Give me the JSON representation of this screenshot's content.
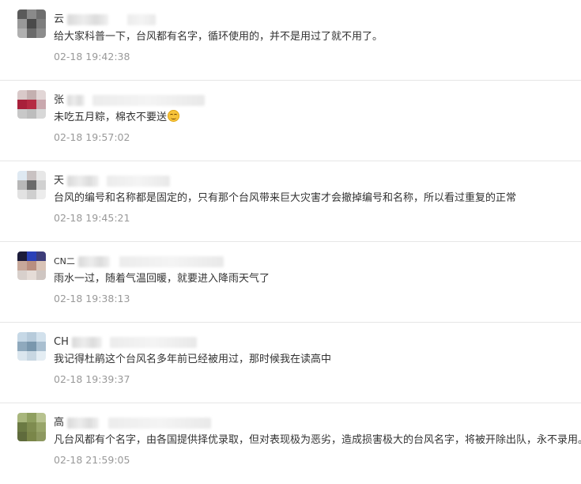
{
  "comments": [
    {
      "name": "云",
      "content": "给大家科普一下，台风都有名字，循环使用的，并不是用过了就不用了。",
      "time": "02-18 19:42:38",
      "avatar_colors": [
        "#5a5a5a",
        "#8a8a8a",
        "#6e6e6e",
        "#999999",
        "#4a4a4a",
        "#7d7d7d",
        "#b0b0b0",
        "#6a6a6a",
        "#8c8c8c"
      ]
    },
    {
      "name": "张",
      "content": "未吃五月粽，棉衣不要送",
      "emoji": "smile-emoji",
      "time": "02-18 19:57:02",
      "avatar_colors": [
        "#d9c9c9",
        "#c4b0b0",
        "#e2d6d6",
        "#a8203a",
        "#b52a42",
        "#c9a8ae",
        "#c8c8c8",
        "#bdbdbd",
        "#d8d8d8"
      ]
    },
    {
      "name": "天",
      "content": "台风的编号和名称都是固定的，只有那个台风带来巨大灾害才会撤掉编号和名称，所以看过重复的正常",
      "time": "02-18 19:45:21",
      "avatar_colors": [
        "#dfe9f2",
        "#c9c2c2",
        "#e7e7e7",
        "#b8b8b8",
        "#6a6a6a",
        "#d1d1d1",
        "#e2e2e2",
        "#cfcfcf",
        "#ececec"
      ]
    },
    {
      "name": "CN二",
      "content": "雨水一过，随着气温回暖，就要进入降雨天气了",
      "time": "02-18 19:38:13",
      "avatar_colors": [
        "#1b1b3a",
        "#2a40b8",
        "#3d3d7a",
        "#c7a89a",
        "#b98f80",
        "#d9c3b6",
        "#d8d0cc",
        "#e5dcd7",
        "#cfc6c2"
      ]
    },
    {
      "name": "CH",
      "content": "我记得杜鹃这个台风名多年前已经被用过，那时候我在读高中",
      "time": "02-18 19:39:37",
      "avatar_colors": [
        "#c6d8e6",
        "#b7cbdb",
        "#d2e1ec",
        "#8fa9bd",
        "#7a97ad",
        "#a9bfd0",
        "#dbe6ee",
        "#c8d7e2",
        "#e4edf3"
      ]
    },
    {
      "name": "高",
      "content": "凡台风都有个名字，由各国提供择优录取，但对表现极为恶劣，造成损害极大的台风名字，将被开除出队，永不录用。",
      "time": "02-18 21:59:05",
      "avatar_colors": [
        "#a8b67c",
        "#8f9f60",
        "#b7c28f",
        "#6b7a43",
        "#7f8c50",
        "#98a56a",
        "#5f6b3c",
        "#7a8649",
        "#8d9860"
      ]
    }
  ]
}
